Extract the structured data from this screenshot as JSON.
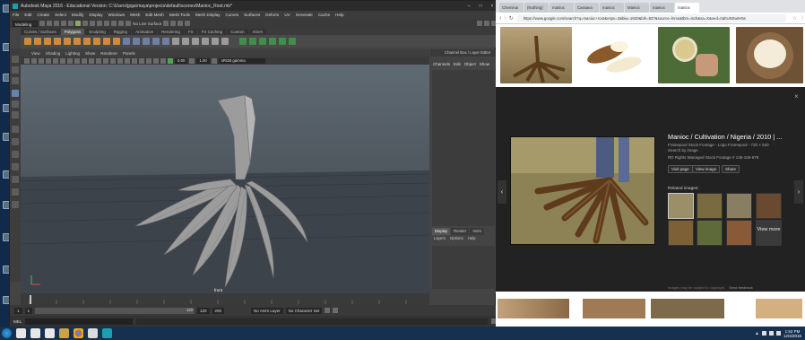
{
  "maya": {
    "title": "Autodesk Maya 2016 - Educational Version: C:\\Users\\jpga\\maya\\projects\\default\\scenes\\Manioc_Root.mb*",
    "menus": [
      "File",
      "Edit",
      "Create",
      "Select",
      "Modify",
      "Display",
      "Windows",
      "Mesh",
      "Edit Mesh",
      "Mesh Tools",
      "Mesh Display",
      "Curves",
      "Surfaces",
      "Deform",
      "UV",
      "Generate",
      "Cache",
      "Help"
    ],
    "mode": "Modeling",
    "live_surface": "No Live Surface",
    "shelf_tabs": [
      "Curves / Surfaces",
      "Polygons",
      "Sculpting",
      "Rigging",
      "Animation",
      "Rendering",
      "FX",
      "FX Caching",
      "Custom",
      "XGen"
    ],
    "active_shelf_tab": "Polygons",
    "viewport_menu": [
      "View",
      "Shading",
      "Lighting",
      "Show",
      "Renderer",
      "Panels"
    ],
    "gamma_field": "sRGB gamma",
    "exposure": "0.00",
    "gamma": "1.00",
    "camera_label": "front",
    "time_start": "1",
    "time_end": "120",
    "range_start": "1",
    "range_current": "1",
    "range_end_a": "120",
    "range_end_b": "200",
    "frame_current": "1.00",
    "anim_layer": "No Anim Layer",
    "char_set": "No Character Set",
    "cmd_label": "MEL",
    "channel_box_title": "Channel Box / Layer Editor",
    "channel_menu": [
      "Channels",
      "Edit",
      "Object",
      "Show"
    ],
    "layer_tabs": [
      "Display",
      "Render",
      "Anim"
    ],
    "active_layer_tab": "Display",
    "layer_menu": [
      "Layers",
      "Options",
      "Help"
    ],
    "colors": {
      "accent": "#5e87b5",
      "viewport_top": "#5f6a73",
      "mesh": "#9a9a9a"
    }
  },
  "chrome": {
    "tabs": [
      "Cheminai",
      "(Nothing)",
      "manioc",
      "Cassava",
      "manioc",
      "Manioc",
      "manioc",
      "manioc"
    ],
    "active_tab_index": 7,
    "url": "https://www.google.com/search?q=manioc+root&espv=2&biw=1920&bih=927&source=lnms&tbm=isch&sa=X&ved=0ahUKEwiH0w",
    "preview_title": "Manioc / Cultivation / Nigeria / 2010 | ...",
    "preview_source": "Framepool Stock Footage - Logo Framepool - 720 × 540",
    "preview_sub": "Search by image",
    "preview_rights": "RD Rights Managed Stock Footage # 136-106-679",
    "buttons": [
      "Visit page",
      "View image",
      "Share"
    ],
    "related_label": "Related images:",
    "view_more": "View more",
    "footer_note": "Images may be subject to copyright.",
    "footer_link": "Send feedback"
  },
  "taskbar": {
    "time": "1:52 PM",
    "date": "12/4/2016"
  }
}
